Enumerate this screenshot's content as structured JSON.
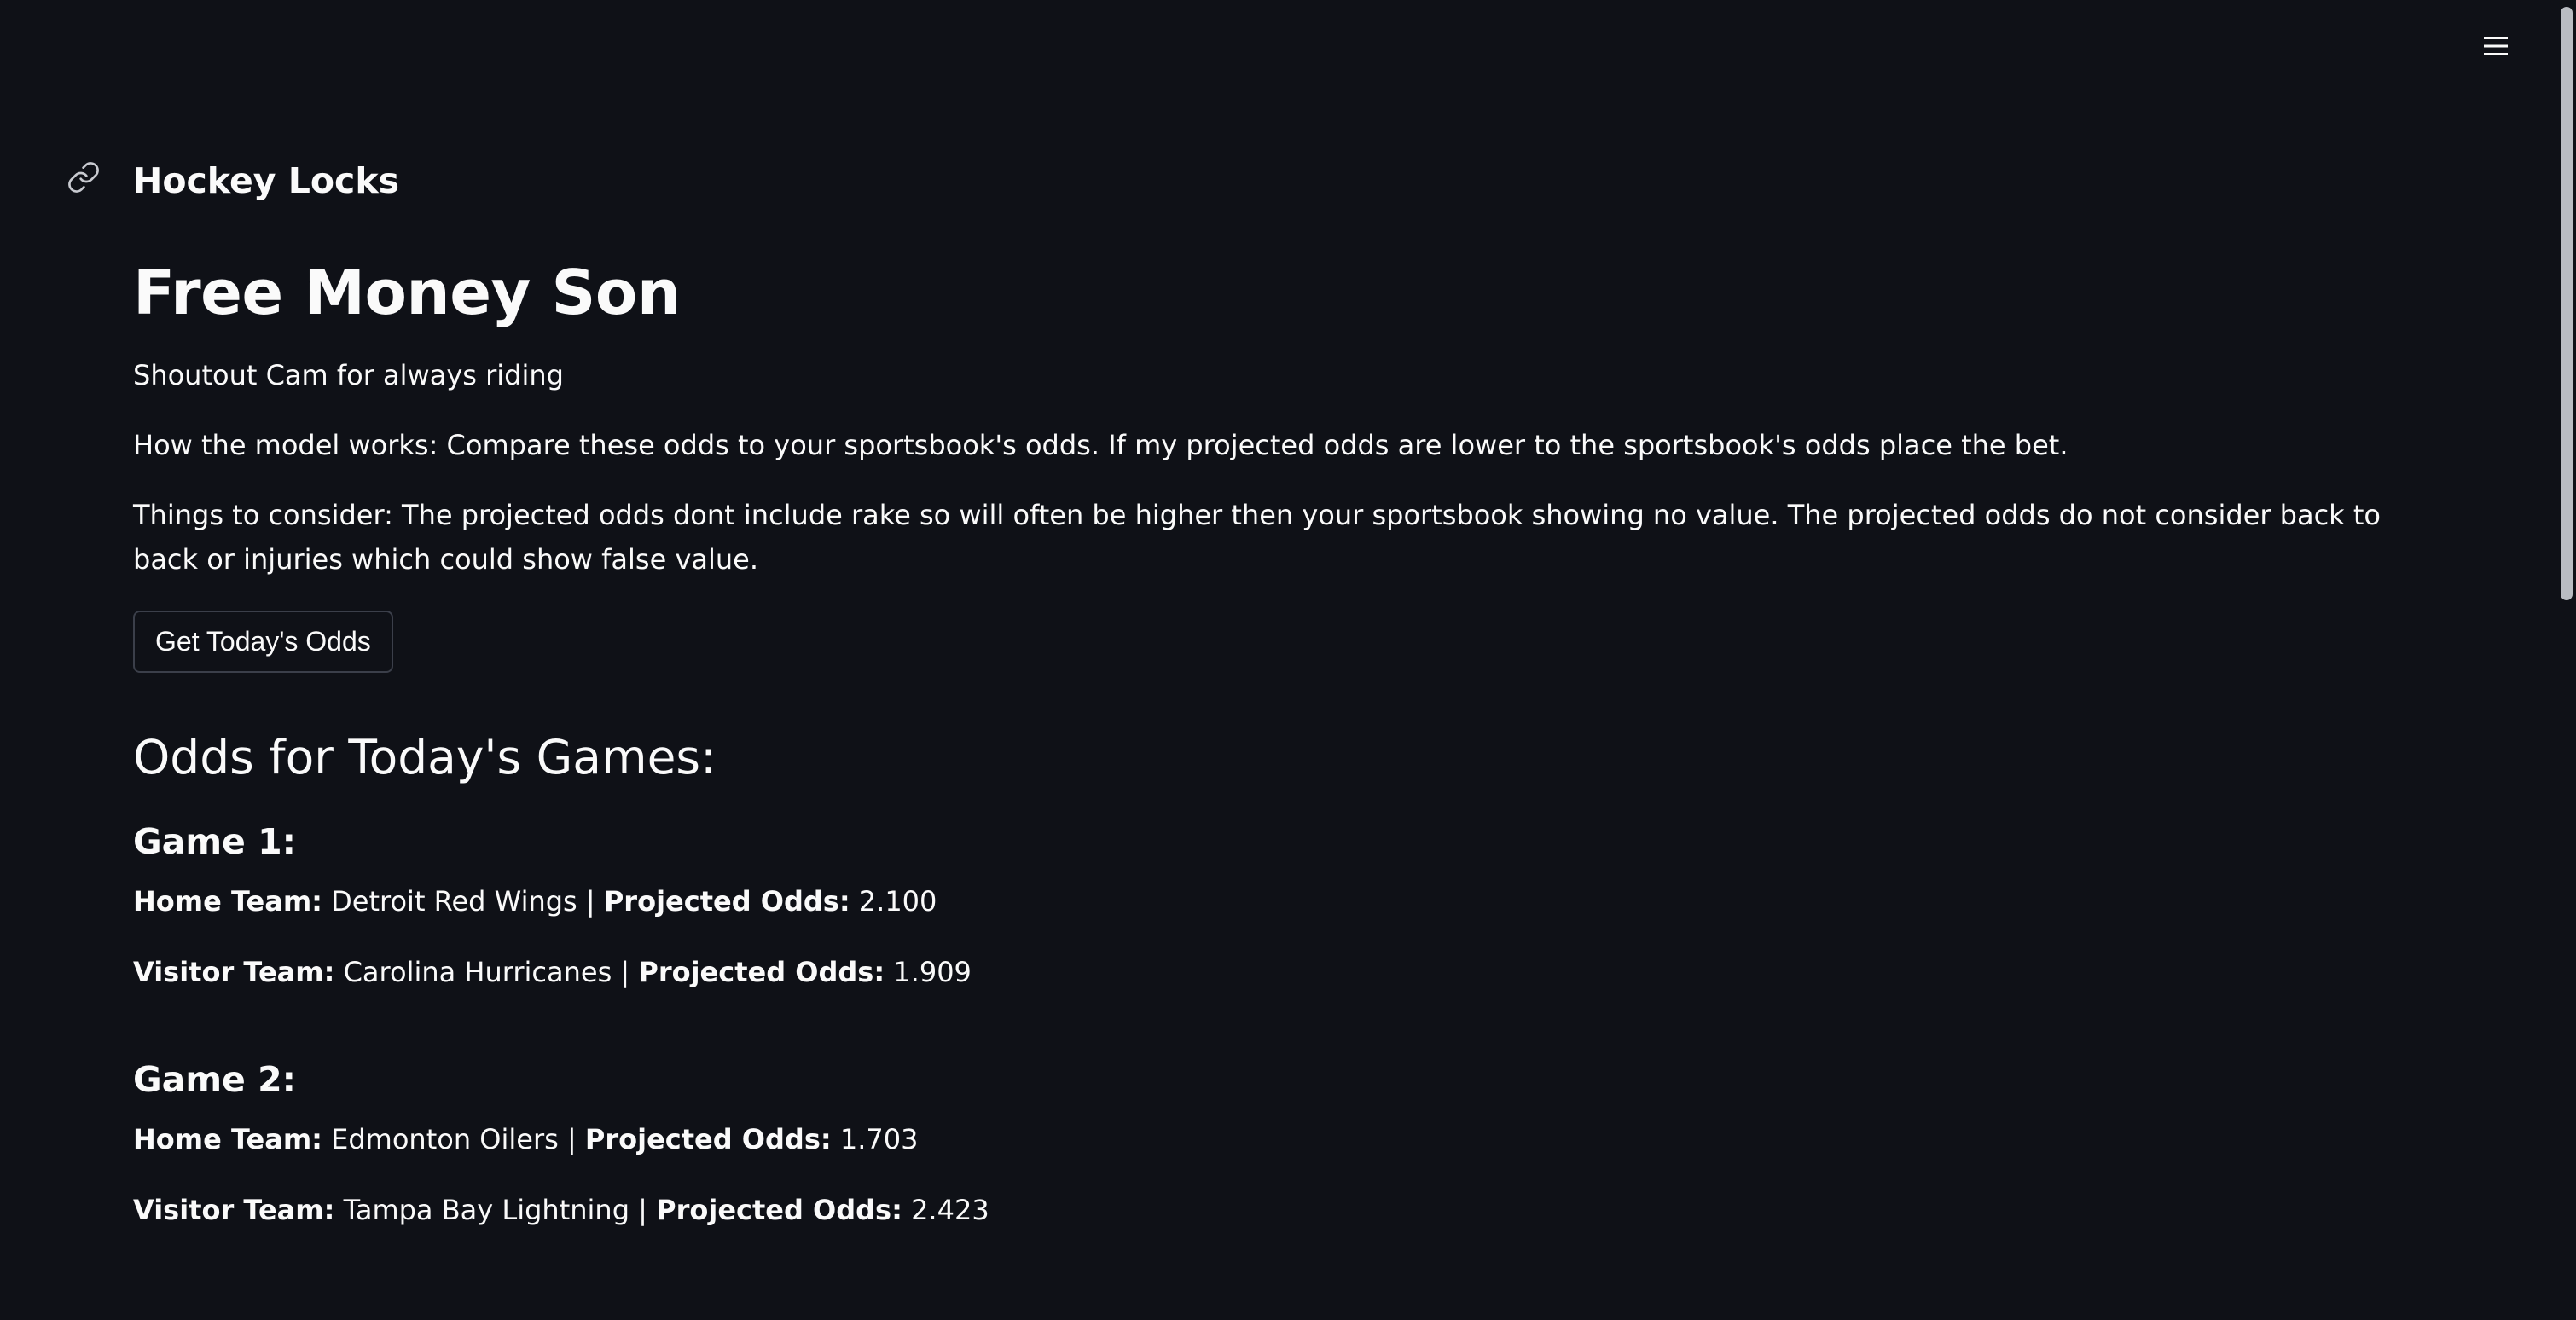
{
  "app": {
    "name": "Hockey Locks"
  },
  "header": {
    "menu_icon": "hamburger-menu-icon",
    "link_icon": "link-icon"
  },
  "main": {
    "title": "Free Money Son",
    "subtitle": "Shoutout Cam for always riding",
    "how_it_works": "How the model works: Compare these odds to your sportsbook's odds. If my projected odds are lower to the sportsbook's odds place the bet.",
    "considerations": "Things to consider: The projected odds dont include rake so will often be higher then your sportsbook showing no value. The projected odds do not consider back to back or injuries which could show false value.",
    "button_label": "Get Today's Odds",
    "section_heading": "Odds for Today's Games:"
  },
  "labels": {
    "home_team": "Home Team:",
    "visitor_team": "Visitor Team:",
    "projected_odds": "Projected Odds:",
    "separator": "|"
  },
  "games": [
    {
      "heading": "Game 1:",
      "home_team": "Detroit Red Wings",
      "home_odds": "2.100",
      "visitor_team": "Carolina Hurricanes",
      "visitor_odds": "1.909"
    },
    {
      "heading": "Game 2:",
      "home_team": "Edmonton Oilers",
      "home_odds": "1.703",
      "visitor_team": "Tampa Bay Lightning",
      "visitor_odds": "2.423"
    }
  ],
  "colors": {
    "background": "#0f1117",
    "text": "#fafafa",
    "button_border": "#3b3f4a"
  }
}
